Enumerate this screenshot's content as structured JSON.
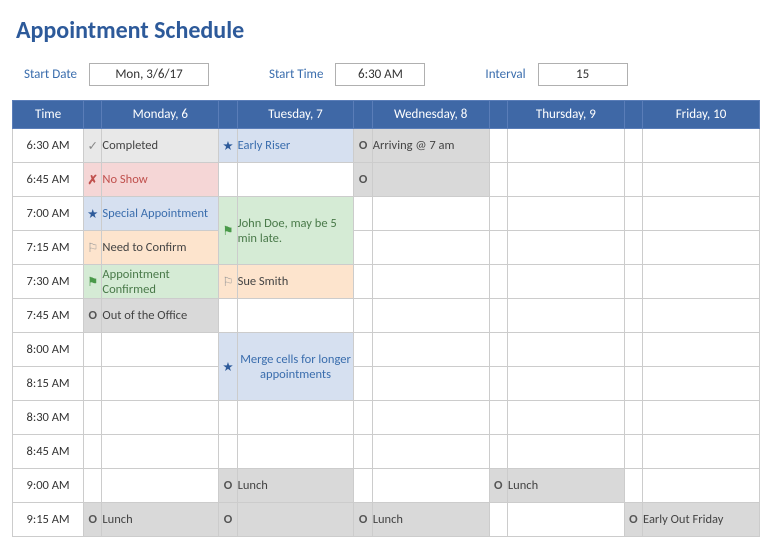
{
  "title": "Appointment Schedule",
  "controls": {
    "start_date_label": "Start Date",
    "start_date_value": "Mon, 3/6/17",
    "start_time_label": "Start Time",
    "start_time_value": "6:30 AM",
    "interval_label": "Interval",
    "interval_value": "15"
  },
  "header": {
    "time": "Time",
    "days": [
      "Monday, 6",
      "Tuesday, 7",
      "Wednesday, 8",
      "Thursday, 9",
      "Friday, 10"
    ]
  },
  "icons": {
    "check": "✓",
    "x": "✗",
    "star": "★",
    "flag": "⚑",
    "flag_outline": "⚐",
    "o": "O"
  },
  "times": [
    "6:30 AM",
    "6:45 AM",
    "7:00 AM",
    "7:15 AM",
    "7:30 AM",
    "7:45 AM",
    "8:00 AM",
    "8:15 AM",
    "8:30 AM",
    "8:45 AM",
    "9:00 AM",
    "9:15 AM"
  ],
  "cells": {
    "mon_630": "Completed",
    "mon_645": "No Show",
    "mon_700": "Special Appointment",
    "mon_715": "Need to Confirm",
    "mon_730": "Appointment Confirmed",
    "mon_745": "Out of the Office",
    "mon_915": "Lunch",
    "tue_630": "Early Riser",
    "tue_700": "John Doe, may be 5 min late.",
    "tue_730": "Sue Smith",
    "tue_800": "Merge cells for longer appointments",
    "tue_900": "Lunch",
    "wed_630": "Arriving @ 7 am",
    "wed_915": "Lunch",
    "thu_900": "Lunch",
    "fri_915": "Early Out Friday"
  }
}
